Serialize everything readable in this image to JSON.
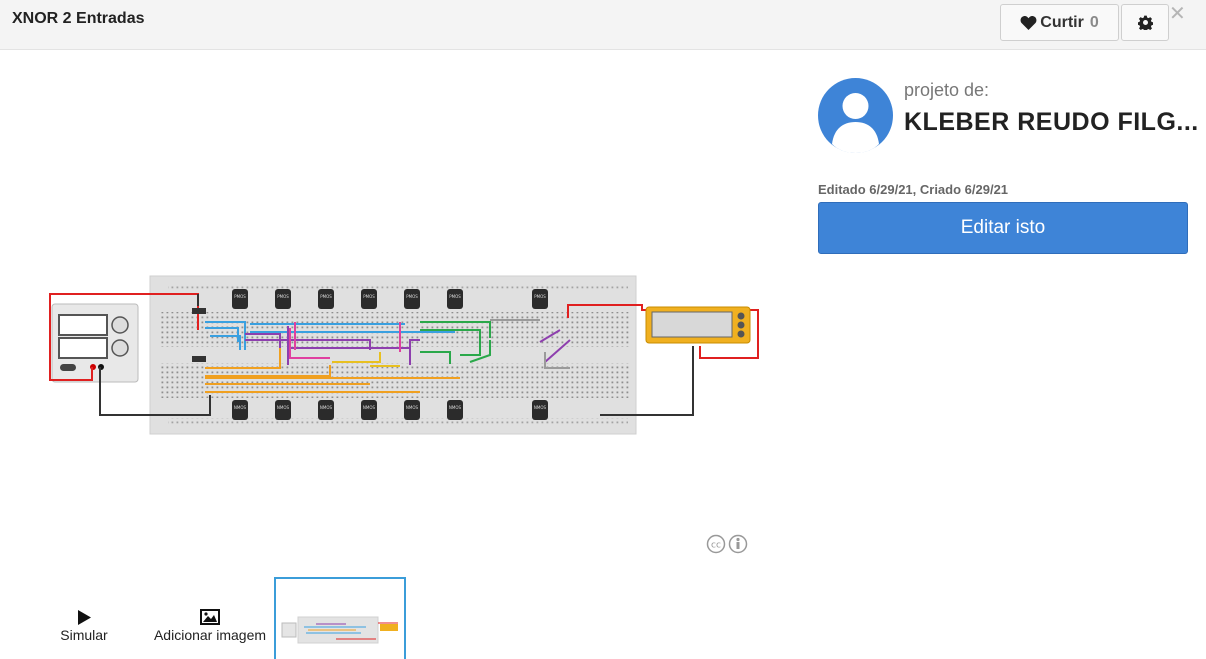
{
  "header": {
    "title": "XNOR 2 Entradas",
    "like_label": "Curtir",
    "like_count": "0",
    "icons": [
      "heart-icon",
      "gear-icon",
      "close-icon"
    ]
  },
  "author_panel": {
    "byline": "projeto de:",
    "author_name": "KLEBER REUDO FILG...",
    "dates": "Editado 6/29/21, Criado 6/29/21",
    "edit_button": "Editar isto",
    "colors": {
      "edit_button": "#3e84d7",
      "avatar": "#3e84d7"
    }
  },
  "circuit": {
    "chip_top_labels": [
      "PMOS",
      "PMOS",
      "PMOS",
      "PMOS",
      "PMOS",
      "PMOS",
      "PMOS"
    ],
    "chip_bottom_labels": [
      "NMOS",
      "NMOS",
      "NMOS",
      "NMOS",
      "NMOS",
      "NMOS",
      "NMOS"
    ],
    "wire_colors": [
      "#e02020",
      "#333333",
      "#3aa0e0",
      "#8e3fae",
      "#e040a0",
      "#2aa84a",
      "#f0a020",
      "#e8c020",
      "#9a9a9a"
    ]
  },
  "toolbar": {
    "simulate_label": "Simular",
    "add_image_label": "Adicionar imagem"
  }
}
